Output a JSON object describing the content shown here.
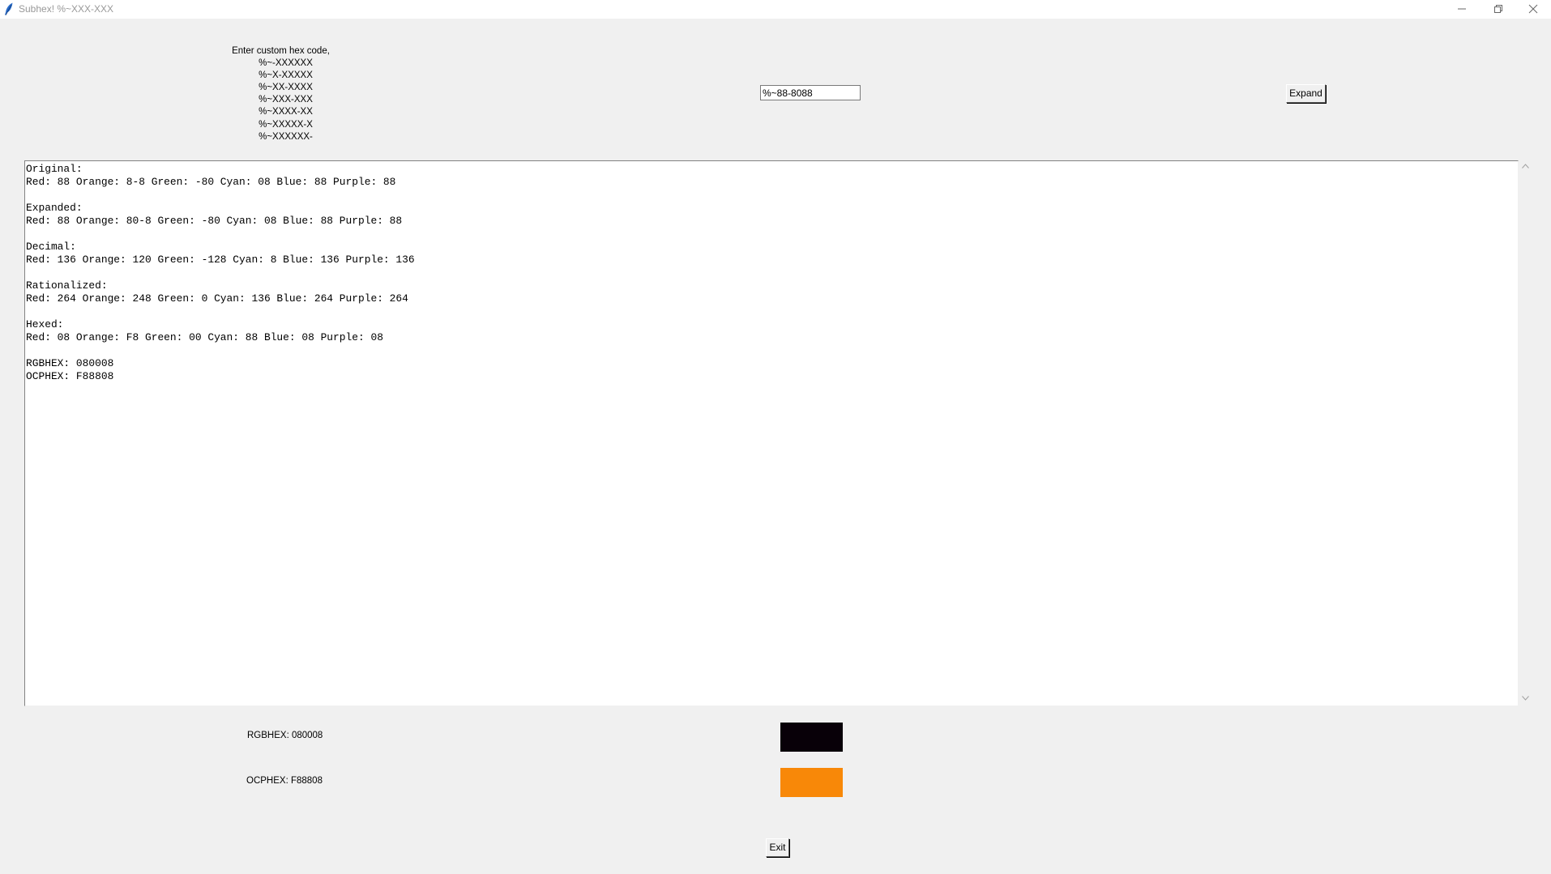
{
  "window": {
    "title": "Subhex! %~XXX-XXX"
  },
  "prompt": {
    "heading": "Enter custom hex code,",
    "formats": [
      "%~-XXXXXX",
      "%~X-XXXXX",
      "%~XX-XXXX",
      "%~XXX-XXX",
      "%~XXXX-XX",
      "%~XXXXX-X",
      "%~XXXXXX-"
    ]
  },
  "input": {
    "value": "%~88-8088"
  },
  "buttons": {
    "expand": "Expand",
    "exit": "Exit"
  },
  "output": {
    "lines": [
      "Original:",
      "Red: 88 Orange: 8-8 Green: -80 Cyan: 08 Blue: 88 Purple: 88",
      "",
      "Expanded:",
      "Red: 88 Orange: 80-8 Green: -80 Cyan: 08 Blue: 88 Purple: 88",
      "",
      "Decimal:",
      "Red: 136 Orange: 120 Green: -128 Cyan: 8 Blue: 136 Purple: 136",
      "",
      "Rationalized:",
      "Red: 264 Orange: 248 Green: 0 Cyan: 136 Blue: 264 Purple: 264",
      "",
      "Hexed:",
      "Red: 08 Orange: F8 Green: 00 Cyan: 88 Blue: 08 Purple: 08",
      "",
      "RGBHEX: 080008",
      "OCPHEX: F88808"
    ]
  },
  "swatches": {
    "rgb_label": "RGBHEX: 080008",
    "rgb_color": "#080008",
    "ocp_label": "OCPHEX: F88808",
    "ocp_color": "#F88808"
  },
  "icons": {
    "app": "feather-icon",
    "minimize": "minimize-icon",
    "restore": "restore-icon",
    "close": "close-icon",
    "scroll_up": "chevron-up-icon",
    "scroll_down": "chevron-down-icon"
  }
}
